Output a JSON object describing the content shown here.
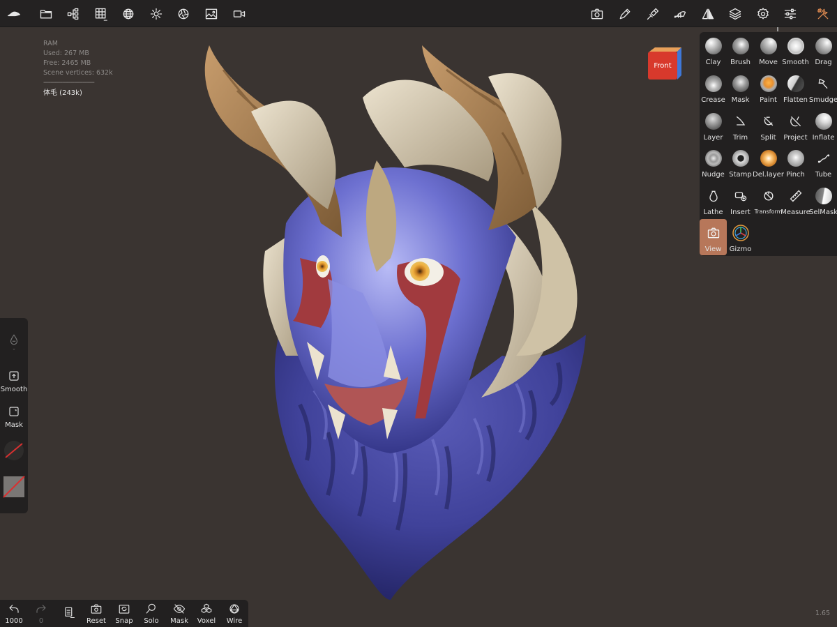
{
  "stats": {
    "title": "RAM",
    "used": "Used: 267 MB",
    "free": "Free: 2465 MB",
    "vertices": "Scene vertices: 632k",
    "separator": "------------------------------",
    "mesh": "体毛 (243k)"
  },
  "view_cube": {
    "label": "Front",
    "colors": {
      "front": "#d8392c",
      "side": "#3f78d8",
      "top": "#e8a05a"
    }
  },
  "toolbar_icons": [
    "logo-icon",
    "folder-icon",
    "scene-tree-icon",
    "grid-icon",
    "sphere-icon",
    "sun-icon",
    "aperture-icon",
    "image-icon",
    "video-icon",
    "camera-icon",
    "pen-icon",
    "stamp-icon",
    "tip-icon",
    "symmetry-icon",
    "layers-icon",
    "settings-icon",
    "sliders-icon",
    "tools-icon"
  ],
  "tools": [
    {
      "label": "Clay",
      "icon": "clay-icon"
    },
    {
      "label": "Brush",
      "icon": "brush-icon"
    },
    {
      "label": "Move",
      "icon": "move-icon"
    },
    {
      "label": "Smooth",
      "icon": "smooth-icon"
    },
    {
      "label": "Drag",
      "icon": "drag-icon"
    },
    {
      "label": "Crease",
      "icon": "crease-icon"
    },
    {
      "label": "Mask",
      "icon": "mask-icon"
    },
    {
      "label": "Paint",
      "icon": "paint-icon"
    },
    {
      "label": "Flatten",
      "icon": "flatten-icon"
    },
    {
      "label": "Smudge",
      "icon": "smudge-icon"
    },
    {
      "label": "Layer",
      "icon": "layer-icon"
    },
    {
      "label": "Trim",
      "icon": "trim-icon"
    },
    {
      "label": "Split",
      "icon": "split-icon"
    },
    {
      "label": "Project",
      "icon": "project-icon"
    },
    {
      "label": "Inflate",
      "icon": "inflate-icon"
    },
    {
      "label": "Nudge",
      "icon": "nudge-icon"
    },
    {
      "label": "Stamp",
      "icon": "stamp-icon"
    },
    {
      "label": "Del.layer",
      "icon": "del-layer-icon"
    },
    {
      "label": "Pinch",
      "icon": "pinch-icon"
    },
    {
      "label": "Tube",
      "icon": "tube-icon"
    },
    {
      "label": "Lathe",
      "icon": "lathe-icon"
    },
    {
      "label": "Insert",
      "icon": "insert-icon"
    },
    {
      "label": "Transform",
      "icon": "transform-icon"
    },
    {
      "label": "Measure",
      "icon": "ruler-icon"
    },
    {
      "label": "SelMask",
      "icon": "selmask-icon"
    },
    {
      "label": "View",
      "icon": "camera-icon",
      "active": true
    },
    {
      "label": "Gizmo",
      "icon": "gizmo-icon"
    }
  ],
  "left_panel": {
    "dot": "-",
    "smooth": "Smooth",
    "mask": "Mask"
  },
  "bottom": {
    "undo_count": "1000",
    "redo_count": "0",
    "reset": "Reset",
    "snap": "Snap",
    "solo": "Solo",
    "mask": "Mask",
    "voxel": "Voxel",
    "wire": "Wire"
  },
  "version": "1.65",
  "accent": "#d9874f",
  "active_color": "#b7775a"
}
